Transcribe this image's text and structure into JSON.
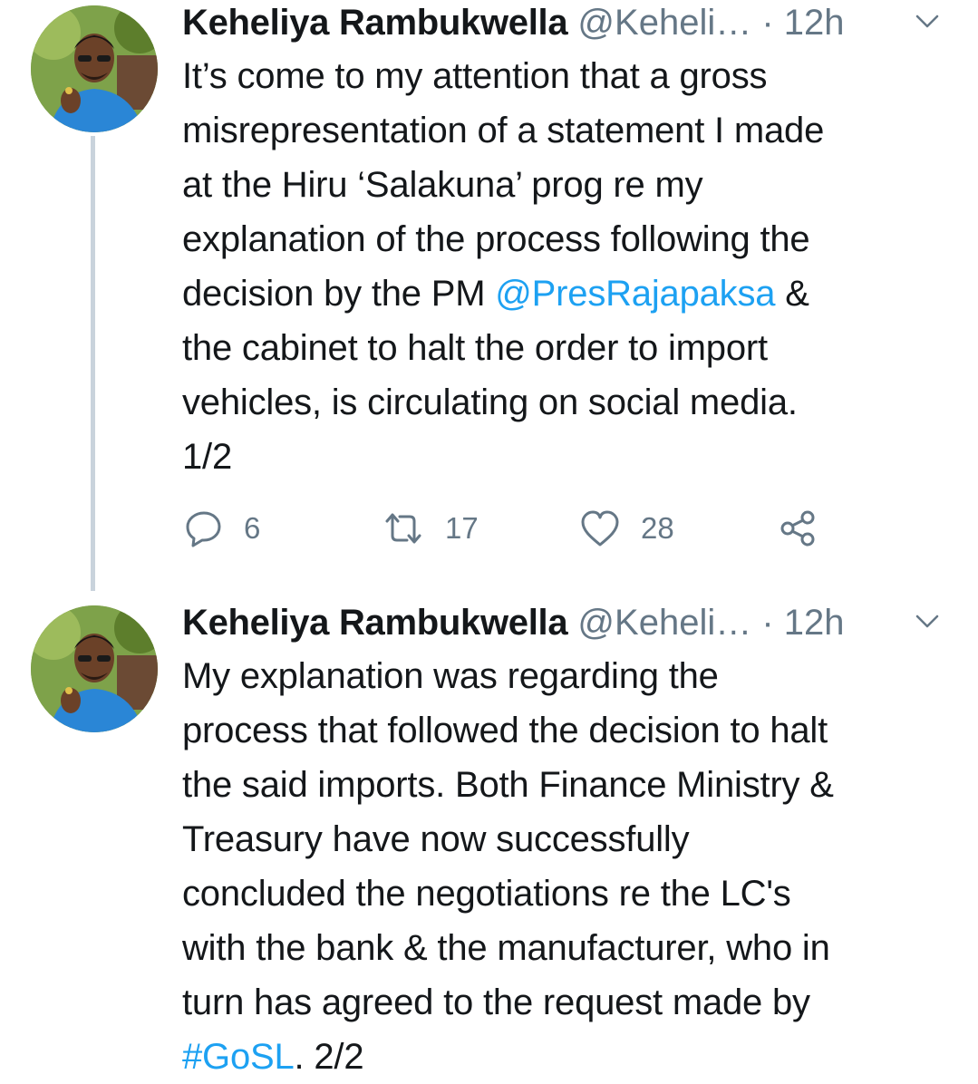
{
  "tweets": [
    {
      "name": "Keheliya Rambukwella",
      "handle": "@Keheli…",
      "separator": "·",
      "time": "12h",
      "avatar_icon": "profile-photo",
      "text": [
        "It’s come to my attention that a gross",
        "misrepresentation of a statement I made",
        "at the Hiru ‘Salakuna’ prog re my",
        "explanation of the process following the"
      ],
      "text_line5_pre": "decision by the PM ",
      "mention": "@PresRajapaksa",
      "text_line5_post": " &",
      "text_rest": [
        "the cabinet to halt the order to import",
        "vehicles, is circulating on social media.",
        "1/2"
      ],
      "replies": "6",
      "retweets": "17",
      "likes": "28"
    },
    {
      "name": "Keheliya Rambukwella",
      "handle": "@Keheli…",
      "separator": "·",
      "time": "12h",
      "avatar_icon": "profile-photo",
      "text": [
        "My explanation was regarding the",
        "process that followed the decision to halt",
        "the said imports. Both Finance Ministry &",
        "Treasury have now successfully",
        "concluded the negotiations re the LC's",
        "with the bank & the manufacturer, who in",
        "turn has agreed to the request made by"
      ],
      "hashtag": "#GoSL",
      "text_end": ". 2/2"
    }
  ],
  "colors": {
    "link": "#1da1f2",
    "muted": "#657786",
    "text": "#14171a",
    "thread_line": "#c9d3dc"
  }
}
